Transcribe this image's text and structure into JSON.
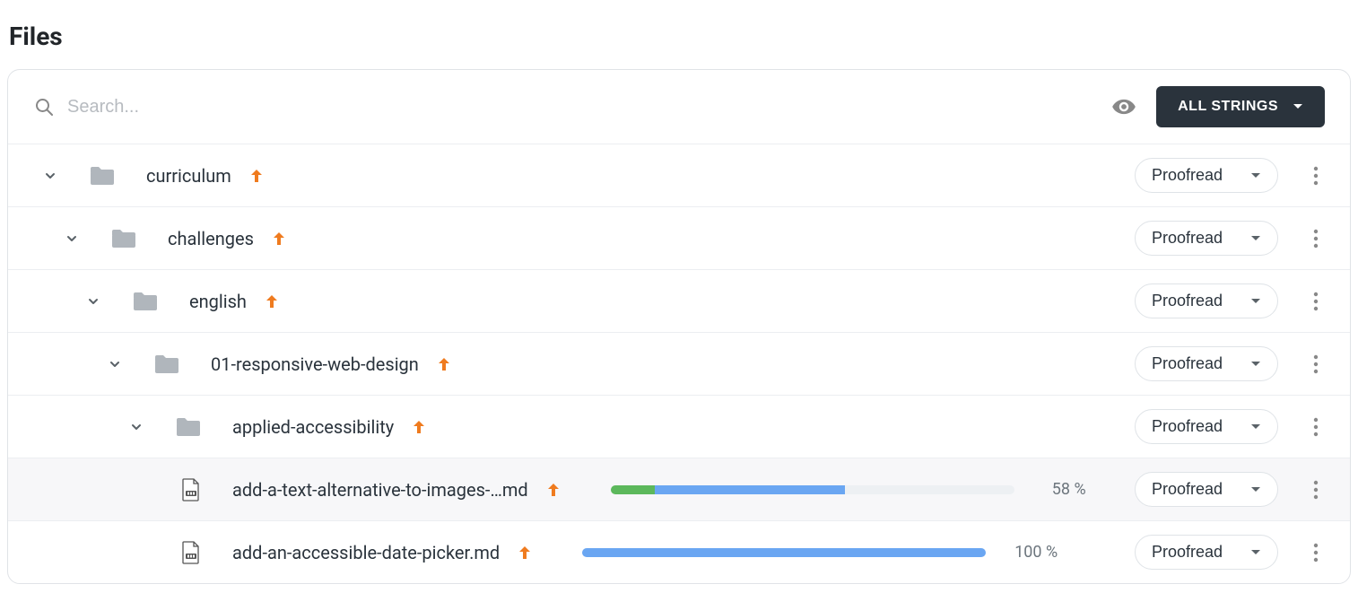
{
  "page_title": "Files",
  "toolbar": {
    "search_placeholder": "Search...",
    "all_strings_label": "ALL STRINGS"
  },
  "proofread_label": "Proofread",
  "rows": [
    {
      "type": "folder",
      "indent": 0,
      "name": "curriculum"
    },
    {
      "type": "folder",
      "indent": 24,
      "name": "challenges"
    },
    {
      "type": "folder",
      "indent": 48,
      "name": "english"
    },
    {
      "type": "folder",
      "indent": 72,
      "name": "01-responsive-web-design"
    },
    {
      "type": "folder",
      "indent": 96,
      "name": "applied-accessibility"
    },
    {
      "type": "file",
      "indent": 156,
      "name": "add-a-text-alternative-to-images-…md",
      "green": 11,
      "blue": 47,
      "pct": "58 %",
      "highlight": true
    },
    {
      "type": "file",
      "indent": 156,
      "name": "add-an-accessible-date-picker.md",
      "green": 0,
      "blue": 100,
      "pct": "100 %",
      "highlight": false
    }
  ]
}
